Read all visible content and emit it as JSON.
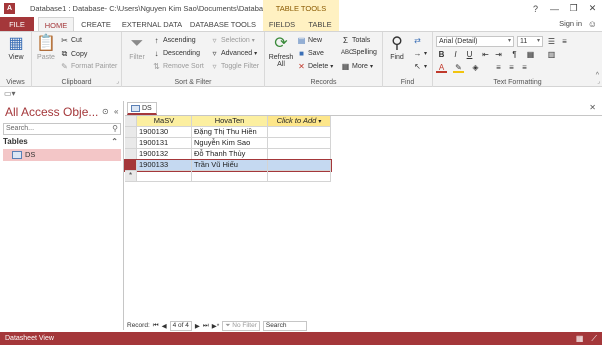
{
  "window": {
    "title": "Database1 : Database- C:\\Users\\Nguyen Kim Sao\\Documents\\Database...",
    "contextual_header": "TABLE TOOLS",
    "controls": [
      "?",
      "—",
      "❐",
      "✕"
    ]
  },
  "qat": [
    "💾",
    "↶",
    "↷",
    "▾"
  ],
  "tabs": {
    "file": "FILE",
    "home": "HOME",
    "create": "CREATE",
    "external": "EXTERNAL DATA",
    "dbtools": "DATABASE TOOLS",
    "fields": "FIELDS",
    "table": "TABLE"
  },
  "account": {
    "signin": "Sign in"
  },
  "ribbon": {
    "views": {
      "label": "Views",
      "view_button": "View"
    },
    "clipboard": {
      "label": "Clipboard",
      "paste": "Paste",
      "cut": "Cut",
      "copy": "Copy",
      "format_painter": "Format Painter"
    },
    "sort_filter": {
      "label": "Sort & Filter",
      "filter": "Filter",
      "ascending": "Ascending",
      "descending": "Descending",
      "remove_sort": "Remove Sort",
      "selection": "Selection",
      "advanced": "Advanced",
      "toggle_filter": "Toggle Filter"
    },
    "records": {
      "label": "Records",
      "refresh": "Refresh All",
      "new": "New",
      "save": "Save",
      "delete": "Delete",
      "totals": "Totals",
      "spelling": "Spelling",
      "more": "More"
    },
    "find": {
      "label": "Find",
      "find": "Find"
    },
    "text_formatting": {
      "label": "Text Formatting",
      "font": "Arial (Detail)",
      "size": "11",
      "bold": "B",
      "italic": "I",
      "underline": "U"
    }
  },
  "nav": {
    "title": "All Access Obje...",
    "search_placeholder": "Search...",
    "group": "Tables",
    "items": [
      {
        "label": "DS"
      }
    ]
  },
  "document": {
    "tab_label": "DS",
    "columns": [
      "MaSV",
      "HovaTen",
      "Click to Add"
    ],
    "rows": [
      {
        "masv": "1900130",
        "hovaten": "Đặng Thị Thu Hiền"
      },
      {
        "masv": "1900131",
        "hovaten": "Nguyễn Kim Sao"
      },
      {
        "masv": "1900132",
        "hovaten": "Đỗ Thanh Thủy"
      },
      {
        "masv": "1900133",
        "hovaten": "Trần Vũ Hiếu"
      }
    ],
    "new_row_marker": "*"
  },
  "record_nav": {
    "label": "Record:",
    "position": "4 of 4",
    "filter": "No Filter",
    "search": "Search"
  },
  "status": {
    "text": "Datasheet View"
  },
  "colors": {
    "accent": "#a4373a",
    "header": "#fcefa0",
    "selected": "#c5d9f1"
  }
}
